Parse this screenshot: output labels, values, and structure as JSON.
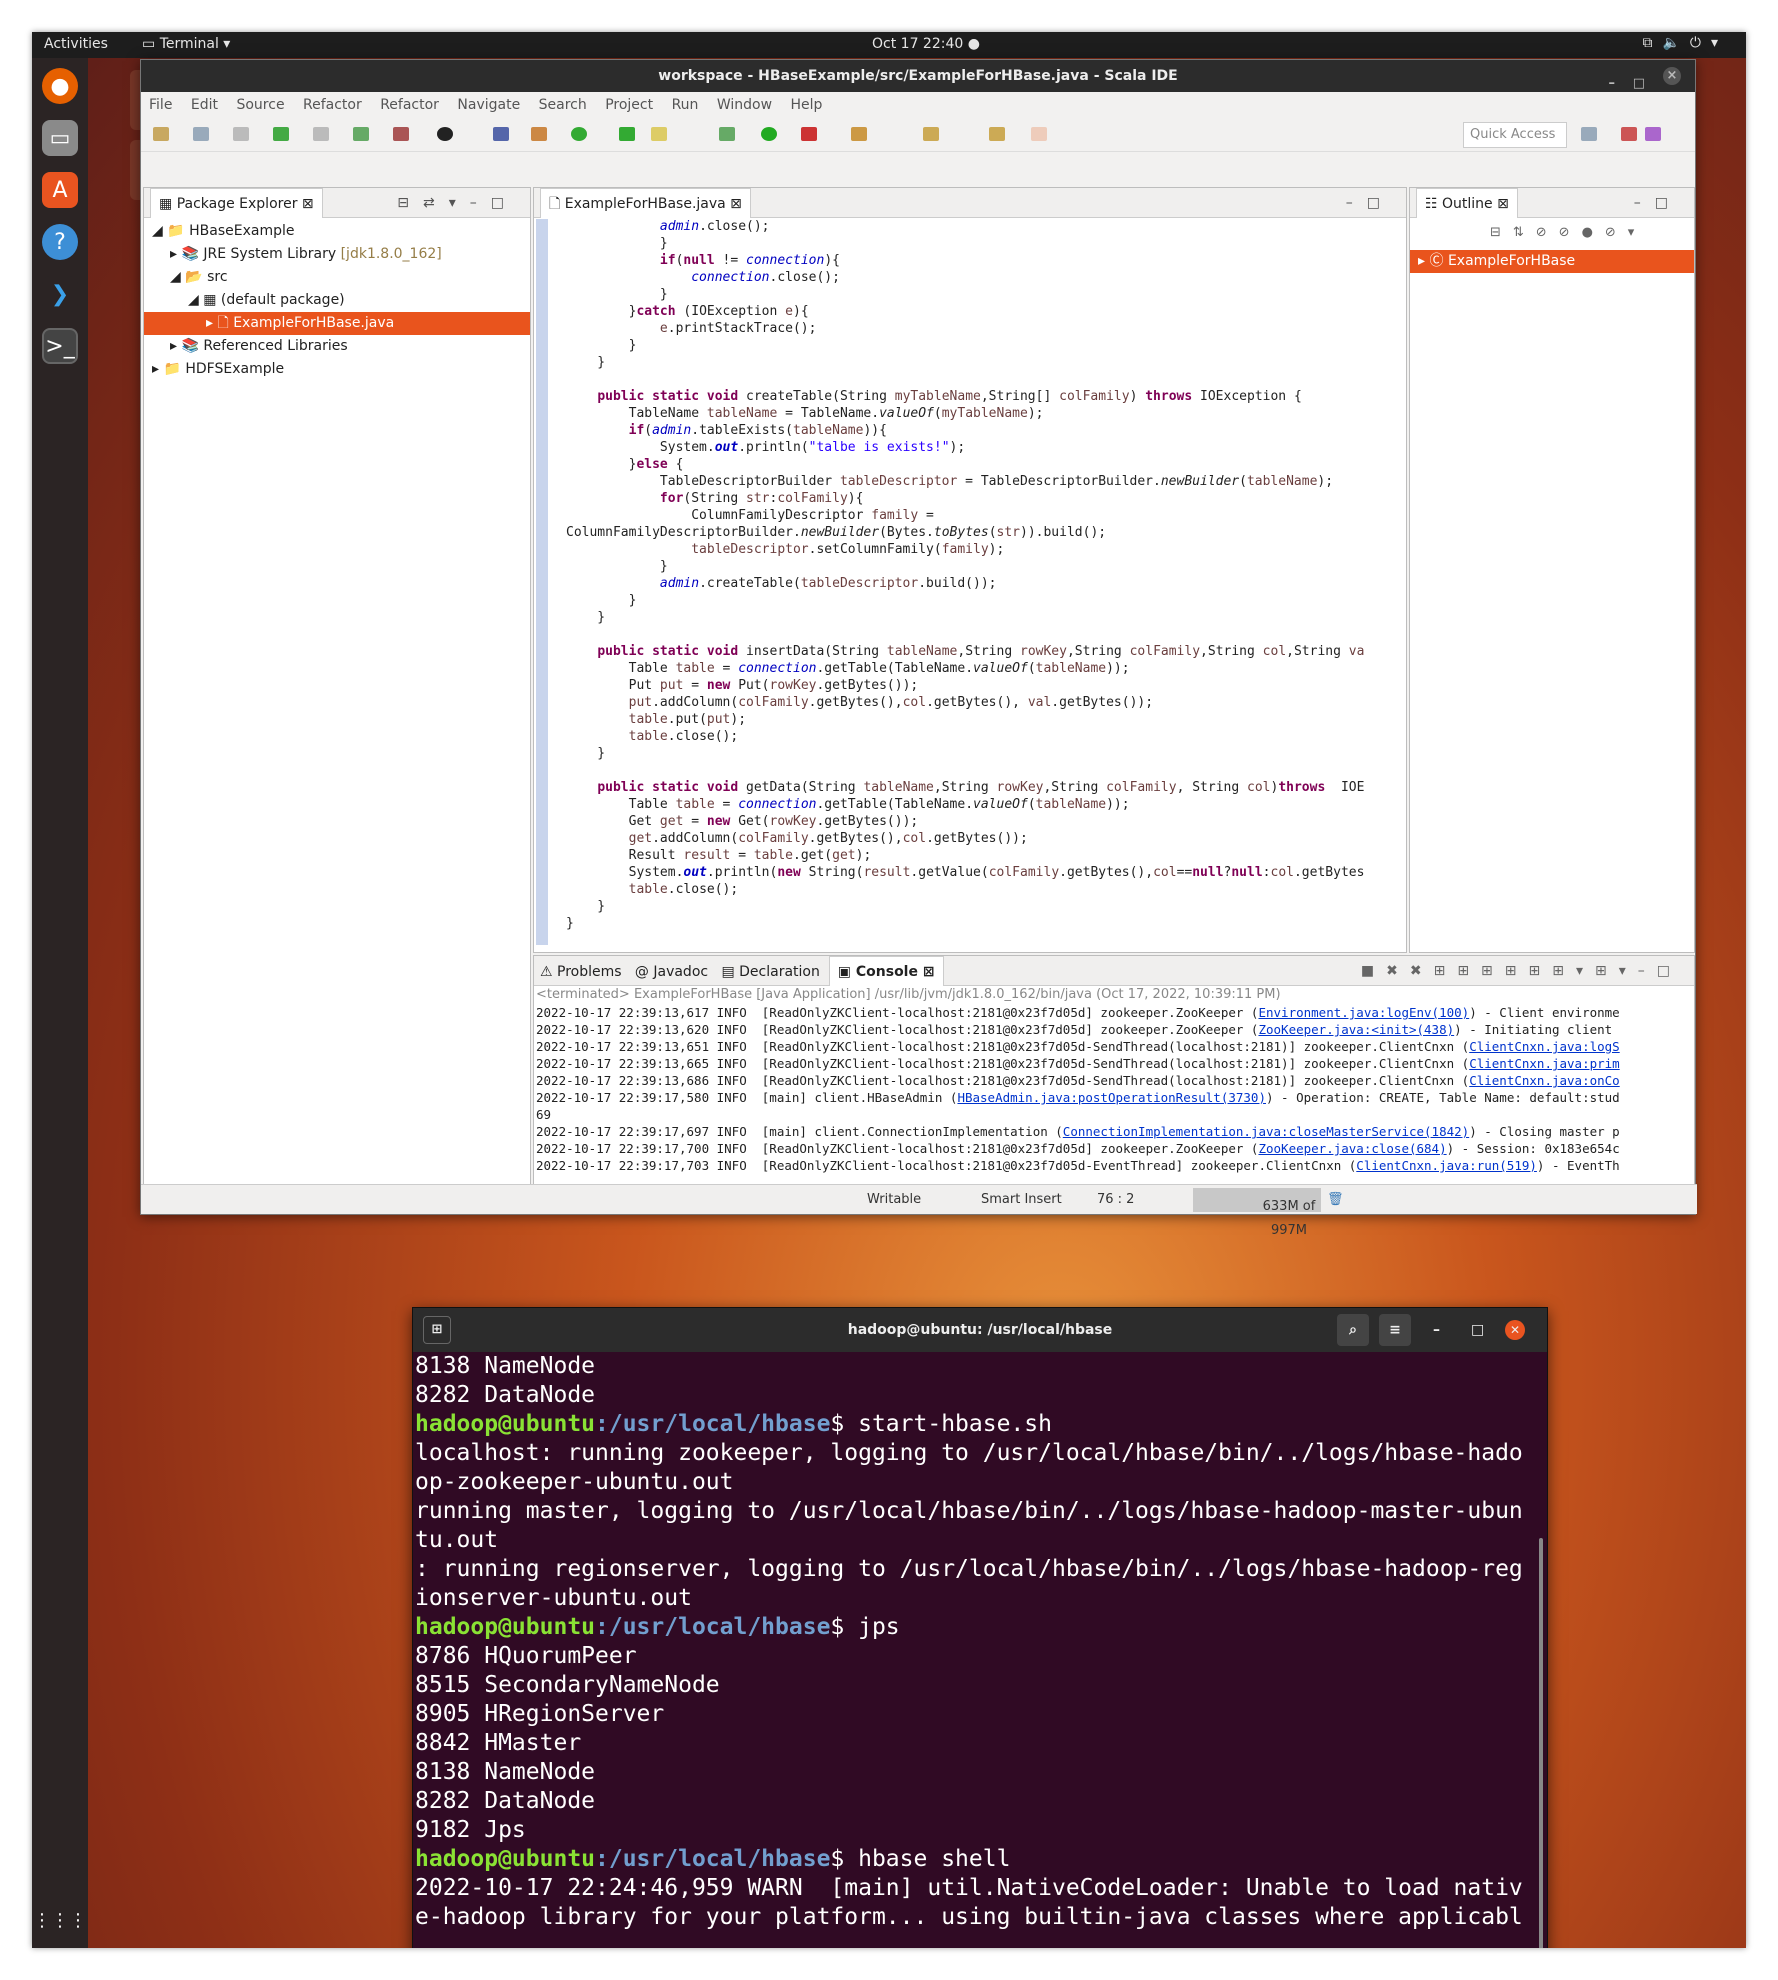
{
  "topbar": {
    "activities": "Activities",
    "app_menu": "Terminal",
    "clock": "Oct 17  22:40"
  },
  "eclipse": {
    "title": "workspace - HBaseExample/src/ExampleForHBase.java - Scala IDE",
    "menu": [
      "File",
      "Edit",
      "Source",
      "Refactor",
      "Refactor",
      "Navigate",
      "Search",
      "Project",
      "Run",
      "Window",
      "Help"
    ],
    "quick_access": "Quick Access",
    "package_explorer": {
      "tab": "Package Explorer",
      "tree": [
        {
          "label": "HBaseExample",
          "extra": ""
        },
        {
          "label": "JRE System Library",
          "extra": "[jdk1.8.0_162]"
        },
        {
          "label": "src",
          "extra": ""
        },
        {
          "label": "(default package)",
          "extra": ""
        },
        {
          "label": "ExampleForHBase.java",
          "extra": ""
        },
        {
          "label": "Referenced Libraries",
          "extra": ""
        },
        {
          "label": "HDFSExample",
          "extra": ""
        }
      ]
    },
    "editor_tab": "ExampleForHBase.java",
    "outline": {
      "tab": "Outline",
      "item": "ExampleForHBase"
    },
    "bottom_tabs": {
      "problems": "Problems",
      "javadoc": "Javadoc",
      "declaration": "Declaration",
      "console": "Console"
    },
    "console_header": "<terminated> ExampleForHBase [Java Application] /usr/lib/jvm/jdk1.8.0_162/bin/java (Oct 17, 2022, 10:39:11 PM)",
    "status": {
      "writable": "Writable",
      "insert": "Smart Insert",
      "position": "76 : 2",
      "memory": "633M of 997M"
    }
  },
  "terminal": {
    "title": "hadoop@ubuntu: /usr/local/hbase",
    "prompt_user": "hadoop@ubuntu",
    "prompt_path": ":/usr/local/hbase",
    "lines": [
      "8138 NameNode",
      "8282 DataNode",
      "$ start-hbase.sh",
      "localhost: running zookeeper, logging to /usr/local/hbase/bin/../logs/hbase-hado",
      "op-zookeeper-ubuntu.out",
      "running master, logging to /usr/local/hbase/bin/../logs/hbase-hadoop-master-ubun",
      "tu.out",
      ": running regionserver, logging to /usr/local/hbase/bin/../logs/hbase-hadoop-reg",
      "ionserver-ubuntu.out",
      "$ jps",
      "8786 HQuorumPeer",
      "8515 SecondaryNameNode",
      "8905 HRegionServer",
      "8842 HMaster",
      "8138 NameNode",
      "8282 DataNode",
      "9182 Jps",
      "$ hbase shell",
      "2022-10-17 22:24:46,959 WARN  [main] util.NativeCodeLoader: Unable to load nativ",
      "e-hadoop library for your platform... using builtin-java classes where applicabl"
    ]
  }
}
